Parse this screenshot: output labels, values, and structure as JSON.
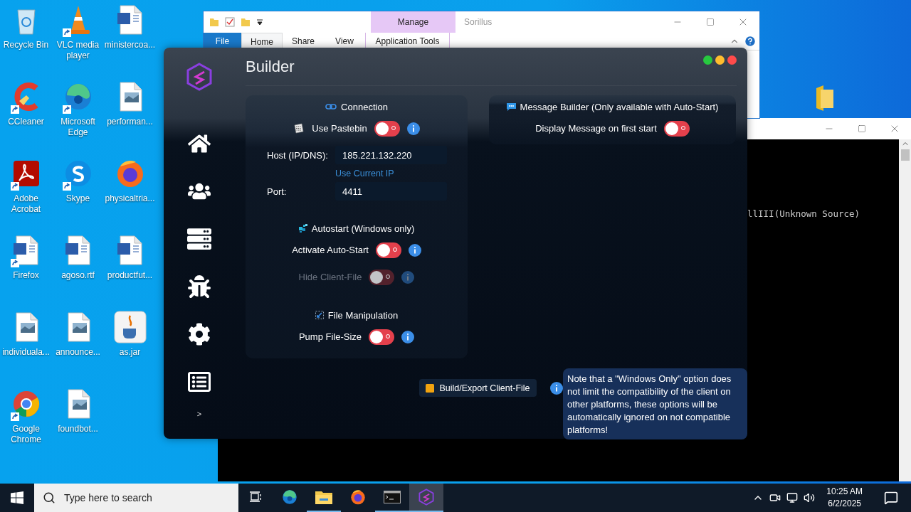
{
  "desktop_icons": [
    {
      "label": "Recycle Bin",
      "shortcut": false
    },
    {
      "label": "VLC media player",
      "shortcut": true
    },
    {
      "label": "ministercoa...",
      "shortcut": false
    },
    {
      "label": "CCleaner",
      "shortcut": true
    },
    {
      "label": "Microsoft Edge",
      "shortcut": true
    },
    {
      "label": "performan...",
      "shortcut": false
    },
    {
      "label": "Adobe Acrobat",
      "shortcut": true
    },
    {
      "label": "Skype",
      "shortcut": true
    },
    {
      "label": "physicaltria...",
      "shortcut": false
    },
    {
      "label": "Firefox",
      "shortcut": true
    },
    {
      "label": "agoso.rtf",
      "shortcut": false
    },
    {
      "label": "productfut...",
      "shortcut": false
    },
    {
      "label": "individuala...",
      "shortcut": false
    },
    {
      "label": "announce...",
      "shortcut": false
    },
    {
      "label": "as.jar",
      "shortcut": false
    },
    {
      "label": "Google Chrome",
      "shortcut": true
    },
    {
      "label": "foundbot...",
      "shortcut": false
    }
  ],
  "explorer": {
    "title": "Sorillus",
    "context_group": "Manage",
    "tabs": [
      {
        "label": "File",
        "kind": "menu",
        "selected": false
      },
      {
        "label": "Home",
        "kind": "tab",
        "selected": true
      },
      {
        "label": "Share",
        "kind": "tab",
        "selected": false
      },
      {
        "label": "View",
        "kind": "tab",
        "selected": false
      },
      {
        "label": "Application Tools",
        "kind": "context",
        "selected": false
      }
    ]
  },
  "console": {
    "lines": [
      "llIII(Unknown Source)"
    ]
  },
  "builder": {
    "title": "Builder",
    "sidebar_toggle": ">",
    "left_card": [
      {
        "title": "Connection",
        "rows": [
          {
            "kind": "toggle",
            "label": "Use Pastebin",
            "on": false,
            "disabled": false,
            "info": true
          },
          {
            "kind": "field",
            "label": "Host (IP/DNS):",
            "value": "185.221.132.220"
          },
          {
            "kind": "link",
            "label": "Use Current IP"
          },
          {
            "kind": "field",
            "label": "Port:",
            "value": "4411"
          }
        ]
      },
      {
        "title": "Autostart (Windows only)",
        "rows": [
          {
            "kind": "toggle",
            "label": "Activate Auto-Start",
            "on": false,
            "disabled": false,
            "info": true
          },
          {
            "kind": "toggle",
            "label": "Hide Client-File",
            "on": false,
            "disabled": true,
            "info": true
          }
        ]
      },
      {
        "title": "File Manipulation",
        "rows": [
          {
            "kind": "toggle",
            "label": "Pump File-Size",
            "on": false,
            "disabled": false,
            "info": true
          }
        ]
      }
    ],
    "right_card": [
      {
        "title": "Message Builder (Only available with Auto-Start)",
        "rows": [
          {
            "kind": "toggle",
            "label": "Display Message on first start",
            "on": false,
            "disabled": false,
            "info": false
          }
        ]
      }
    ],
    "build_button": "Build/Export Client-File",
    "tooltip": "Note that a \"Windows Only\" option does not limit the compatibility of the client on other platforms, these options will be automatically ignored on not compatible platforms!"
  },
  "taskbar": {
    "search_placeholder": "Type here to search",
    "apps": [
      {
        "running": false,
        "selected": false
      },
      {
        "running": false,
        "selected": false
      },
      {
        "running": true,
        "selected": false
      },
      {
        "running": false,
        "selected": false
      },
      {
        "running": true,
        "selected": false
      },
      {
        "running": true,
        "selected": true
      }
    ],
    "time": "10:25 AM",
    "date": "6/2/2025"
  }
}
